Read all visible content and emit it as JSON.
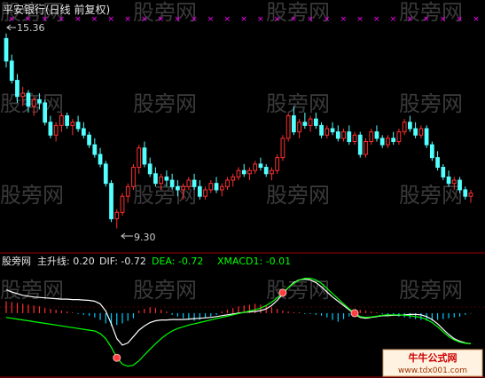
{
  "header": {
    "title": "平安银行(日线 前复权)",
    "title_color": "#e6e6e6"
  },
  "price_panel": {
    "max_label": "15.36",
    "min_label": "9.30",
    "marker_color": "#ff00ff"
  },
  "indicator_panel": {
    "label_prefix": "股旁网",
    "label_main": "主升线: 0.20",
    "label_dif": "DIF: -0.72",
    "label_dea": "DEA: -0.72",
    "label_xmacd": "XMACD1: -0.01",
    "colors": {
      "dif": "#ffffff",
      "dea": "#00ff00",
      "xmacd_up": "#ff3030",
      "xmacd_down": "#00ccff",
      "signal": "#ff4040"
    }
  },
  "watermark": {
    "text": "股旁网",
    "corner_text": "www.tdx001.com",
    "corner_brand": "牛牛公式网"
  },
  "chart_data": [
    {
      "type": "candlestick",
      "title": "平安银行(日线 前复权)",
      "annotations": [
        "15.36",
        "9.30"
      ],
      "ylim": [
        8.9,
        15.9
      ],
      "up_color": "#ff3030",
      "down_color": "#54ffff",
      "bars": [
        [
          15.2,
          15.36,
          14.3,
          14.5
        ],
        [
          14.5,
          14.7,
          13.8,
          13.9
        ],
        [
          13.9,
          14.1,
          13.2,
          13.4
        ],
        [
          13.4,
          13.7,
          13.1,
          13.5
        ],
        [
          13.5,
          13.6,
          12.9,
          13.1
        ],
        [
          13.1,
          13.4,
          12.8,
          13.3
        ],
        [
          13.3,
          13.5,
          13.0,
          13.2
        ],
        [
          13.2,
          13.3,
          12.5,
          12.6
        ],
        [
          12.6,
          12.8,
          12.1,
          12.2
        ],
        [
          12.2,
          12.6,
          12.0,
          12.5
        ],
        [
          12.5,
          12.9,
          12.3,
          12.8
        ],
        [
          12.8,
          12.9,
          12.4,
          12.5
        ],
        [
          12.5,
          12.7,
          12.2,
          12.6
        ],
        [
          12.6,
          12.8,
          12.3,
          12.4
        ],
        [
          12.4,
          12.6,
          12.1,
          12.2
        ],
        [
          12.2,
          12.3,
          11.8,
          11.9
        ],
        [
          11.9,
          12.1,
          11.5,
          11.6
        ],
        [
          11.6,
          11.8,
          11.2,
          11.3
        ],
        [
          11.3,
          11.4,
          10.6,
          10.7
        ],
        [
          10.7,
          10.8,
          9.5,
          9.6
        ],
        [
          9.6,
          9.9,
          9.3,
          9.8
        ],
        [
          9.8,
          10.4,
          9.7,
          10.3
        ],
        [
          10.3,
          10.7,
          10.1,
          10.6
        ],
        [
          10.6,
          11.3,
          10.5,
          11.2
        ],
        [
          11.2,
          11.9,
          11.0,
          11.8
        ],
        [
          11.8,
          12.0,
          11.2,
          11.3
        ],
        [
          11.3,
          11.5,
          10.9,
          11.0
        ],
        [
          11.0,
          11.2,
          10.6,
          10.7
        ],
        [
          10.7,
          11.0,
          10.5,
          10.9
        ],
        [
          10.9,
          11.1,
          10.6,
          10.8
        ],
        [
          10.8,
          11.0,
          10.5,
          10.6
        ],
        [
          10.6,
          10.8,
          10.3,
          10.5
        ],
        [
          10.5,
          10.7,
          10.2,
          10.6
        ],
        [
          10.6,
          10.9,
          10.5,
          10.8
        ],
        [
          10.8,
          11.0,
          10.5,
          10.6
        ],
        [
          10.6,
          10.8,
          10.2,
          10.3
        ],
        [
          10.3,
          10.6,
          10.2,
          10.5
        ],
        [
          10.5,
          10.8,
          10.4,
          10.7
        ],
        [
          10.7,
          10.9,
          10.4,
          10.5
        ],
        [
          10.5,
          10.7,
          10.3,
          10.6
        ],
        [
          10.6,
          10.9,
          10.5,
          10.8
        ],
        [
          10.8,
          11.0,
          10.6,
          10.9
        ],
        [
          10.9,
          11.2,
          10.8,
          11.1
        ],
        [
          11.1,
          11.3,
          10.9,
          11.0
        ],
        [
          11.0,
          11.2,
          10.8,
          11.1
        ],
        [
          11.1,
          11.4,
          11.0,
          11.3
        ],
        [
          11.3,
          11.5,
          11.1,
          11.2
        ],
        [
          11.2,
          11.3,
          10.9,
          11.0
        ],
        [
          11.0,
          11.2,
          10.8,
          11.1
        ],
        [
          11.1,
          11.6,
          11.0,
          11.5
        ],
        [
          11.5,
          12.2,
          11.4,
          12.1
        ],
        [
          12.1,
          12.9,
          12.0,
          12.8
        ],
        [
          12.8,
          13.1,
          12.2,
          12.3
        ],
        [
          12.3,
          12.7,
          12.1,
          12.6
        ],
        [
          12.6,
          12.9,
          12.4,
          12.5
        ],
        [
          12.5,
          12.8,
          12.3,
          12.7
        ],
        [
          12.7,
          12.9,
          12.4,
          12.5
        ],
        [
          12.5,
          12.6,
          12.1,
          12.2
        ],
        [
          12.2,
          12.5,
          12.1,
          12.4
        ],
        [
          12.4,
          12.6,
          12.2,
          12.3
        ],
        [
          12.3,
          12.5,
          12.0,
          12.1
        ],
        [
          12.1,
          12.4,
          12.0,
          12.3
        ],
        [
          12.3,
          12.5,
          11.9,
          12.0
        ],
        [
          12.0,
          12.3,
          11.9,
          12.2
        ],
        [
          12.2,
          12.3,
          11.5,
          11.6
        ],
        [
          11.6,
          12.1,
          11.5,
          12.0
        ],
        [
          12.0,
          12.4,
          11.9,
          12.3
        ],
        [
          12.3,
          12.5,
          12.0,
          12.1
        ],
        [
          12.1,
          12.2,
          11.8,
          11.9
        ],
        [
          11.9,
          12.2,
          11.8,
          12.1
        ],
        [
          12.1,
          12.3,
          11.9,
          12.0
        ],
        [
          12.0,
          12.4,
          11.9,
          12.3
        ],
        [
          12.3,
          12.7,
          12.2,
          12.6
        ],
        [
          12.6,
          12.8,
          12.3,
          12.4
        ],
        [
          12.4,
          12.6,
          12.1,
          12.2
        ],
        [
          12.2,
          12.5,
          12.1,
          12.4
        ],
        [
          12.4,
          12.5,
          11.8,
          11.9
        ],
        [
          11.9,
          12.0,
          11.4,
          11.5
        ],
        [
          11.5,
          11.7,
          11.1,
          11.2
        ],
        [
          11.2,
          11.3,
          10.8,
          10.9
        ],
        [
          10.9,
          11.1,
          10.6,
          10.7
        ],
        [
          10.7,
          10.9,
          10.5,
          10.8
        ],
        [
          10.8,
          10.9,
          10.4,
          10.5
        ],
        [
          10.5,
          10.6,
          10.2,
          10.3
        ],
        [
          10.3,
          10.5,
          10.1,
          10.4
        ]
      ]
    },
    {
      "type": "line",
      "title": "主升线 / MACD",
      "ylim": [
        -1.4,
        1.0
      ],
      "series": [
        {
          "name": "DIF",
          "color": "#ffffff",
          "values": [
            0.55,
            0.5,
            0.46,
            0.42,
            0.4,
            0.38,
            0.37,
            0.36,
            0.35,
            0.34,
            0.33,
            0.33,
            0.32,
            0.32,
            0.31,
            0.3,
            0.28,
            0.22,
            0.05,
            -0.25,
            -0.6,
            -0.75,
            -0.7,
            -0.55,
            -0.4,
            -0.3,
            -0.22,
            -0.18,
            -0.16,
            -0.16,
            -0.15,
            -0.15,
            -0.15,
            -0.14,
            -0.13,
            -0.12,
            -0.11,
            -0.1,
            -0.08,
            -0.06,
            -0.04,
            -0.02,
            0.0,
            0.02,
            0.03,
            0.04,
            0.06,
            0.1,
            0.18,
            0.3,
            0.45,
            0.6,
            0.72,
            0.78,
            0.8,
            0.78,
            0.72,
            0.62,
            0.5,
            0.38,
            0.28,
            0.18,
            0.08,
            -0.02,
            -0.1,
            -0.12,
            -0.1,
            -0.08,
            -0.06,
            -0.06,
            -0.05,
            -0.05,
            -0.04,
            -0.03,
            -0.03,
            -0.04,
            -0.08,
            -0.15,
            -0.25,
            -0.38,
            -0.5,
            -0.6,
            -0.66,
            -0.7,
            -0.72
          ]
        },
        {
          "name": "DEA",
          "color": "#00ff00",
          "values": [
            -0.1,
            -0.12,
            -0.14,
            -0.16,
            -0.18,
            -0.2,
            -0.22,
            -0.24,
            -0.26,
            -0.28,
            -0.3,
            -0.32,
            -0.34,
            -0.36,
            -0.38,
            -0.4,
            -0.42,
            -0.48,
            -0.6,
            -0.8,
            -1.05,
            -1.2,
            -1.25,
            -1.22,
            -1.12,
            -0.98,
            -0.85,
            -0.72,
            -0.6,
            -0.5,
            -0.42,
            -0.36,
            -0.32,
            -0.28,
            -0.25,
            -0.22,
            -0.19,
            -0.16,
            -0.13,
            -0.1,
            -0.07,
            -0.04,
            -0.01,
            0.02,
            0.05,
            0.08,
            0.12,
            0.18,
            0.26,
            0.36,
            0.48,
            0.6,
            0.7,
            0.78,
            0.82,
            0.82,
            0.78,
            0.7,
            0.58,
            0.46,
            0.34,
            0.22,
            0.1,
            0.0,
            -0.08,
            -0.1,
            -0.09,
            -0.07,
            -0.05,
            -0.04,
            -0.04,
            -0.04,
            -0.05,
            -0.06,
            -0.08,
            -0.1,
            -0.15,
            -0.22,
            -0.32,
            -0.44,
            -0.55,
            -0.63,
            -0.68,
            -0.71,
            -0.72
          ]
        }
      ],
      "bars": {
        "name": "XMACD1",
        "values": [
          0.28,
          0.26,
          0.24,
          0.22,
          0.2,
          0.18,
          0.16,
          0.12,
          0.1,
          0.08,
          0.06,
          0.04,
          0.02,
          -0.02,
          -0.04,
          -0.06,
          -0.1,
          -0.16,
          -0.24,
          -0.3,
          -0.28,
          -0.24,
          -0.18,
          -0.12,
          0.06,
          0.1,
          0.14,
          0.12,
          0.08,
          0.04,
          -0.04,
          -0.08,
          -0.12,
          -0.16,
          -0.18,
          -0.16,
          -0.12,
          -0.08,
          -0.04,
          0.04,
          0.08,
          0.12,
          0.16,
          0.18,
          0.2,
          0.22,
          0.2,
          0.18,
          0.14,
          0.1,
          0.06,
          0.04,
          0.02,
          0.02,
          -0.02,
          -0.02,
          -0.04,
          -0.06,
          -0.1,
          -0.16,
          -0.2,
          -0.14,
          -0.08,
          0.04,
          0.08,
          0.06,
          0.04,
          0.02,
          -0.02,
          -0.04,
          -0.06,
          -0.08,
          -0.1,
          -0.12,
          -0.14,
          -0.16,
          -0.18,
          -0.18,
          -0.16,
          -0.14,
          -0.12,
          -0.1,
          -0.08,
          -0.04,
          -0.01
        ]
      },
      "signals": [
        20,
        50,
        63
      ]
    }
  ]
}
